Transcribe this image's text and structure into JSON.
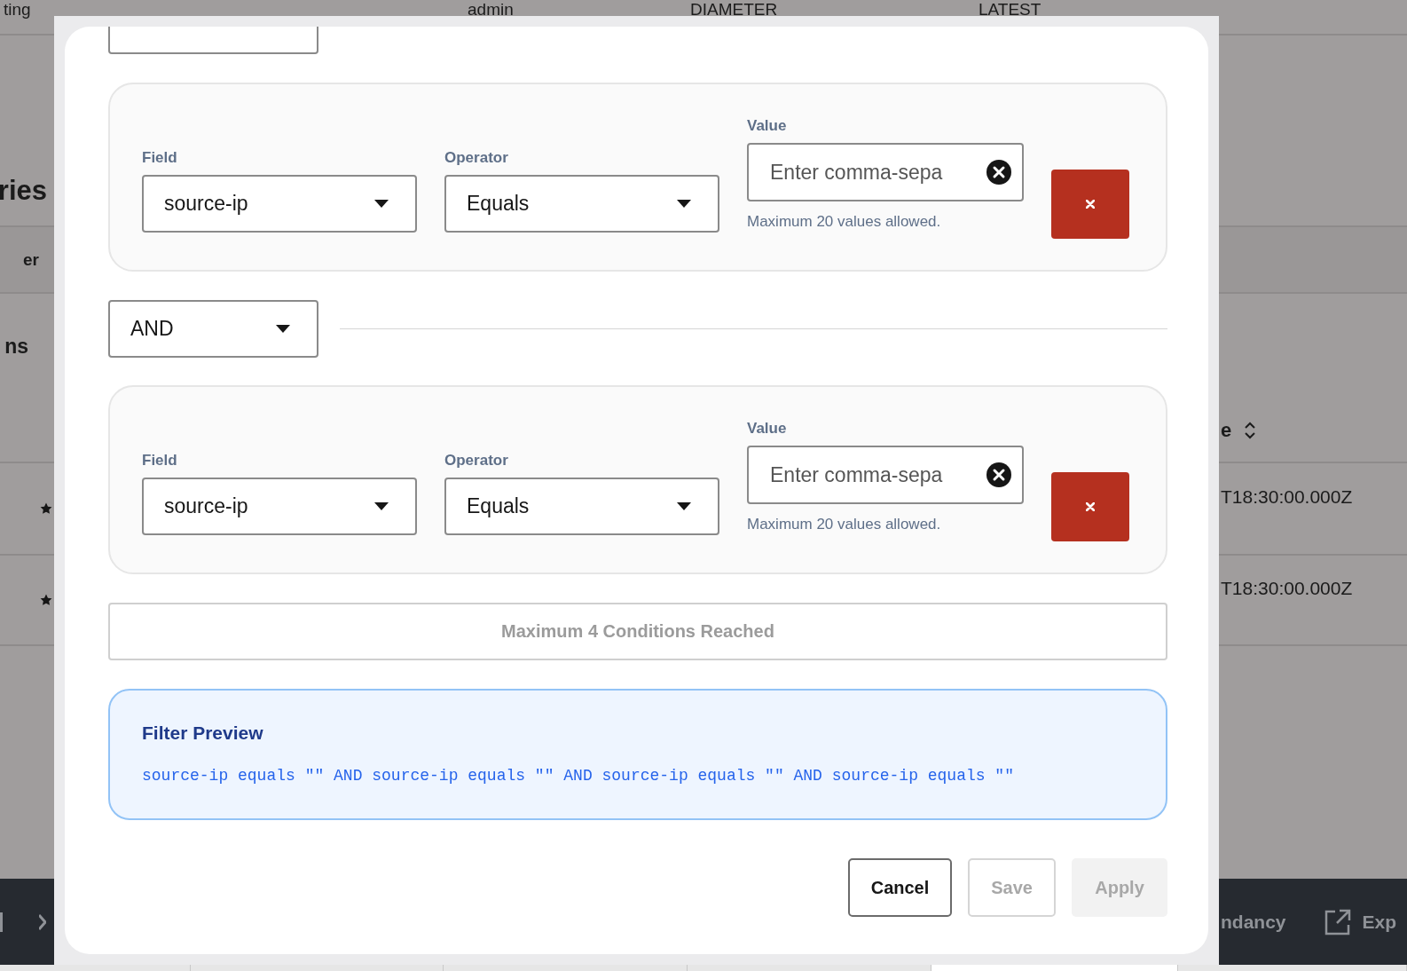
{
  "background": {
    "header_cells": [
      "ting",
      "admin",
      "DIAMETER",
      "LATEST"
    ],
    "left_texts": [
      "ries",
      "er",
      "ns"
    ],
    "sort_header": "e",
    "rows": [
      {
        "timestamp": "T18:30:00.000Z"
      },
      {
        "timestamp": "T18:30:00.000Z"
      }
    ],
    "footer_items": [
      {
        "kind": "text",
        "label": "ndancy"
      },
      {
        "kind": "export",
        "label": "Exp"
      }
    ]
  },
  "dialog": {
    "items": [
      {
        "kind": "join_cut"
      },
      {
        "kind": "condition",
        "field_label": "Field",
        "field": "source-ip",
        "operator_label": "Operator",
        "operator": "Equals",
        "value_label": "Value",
        "value_placeholder": "Enter comma-sepa",
        "hint": "Maximum 20 values allowed."
      },
      {
        "kind": "join",
        "value": "AND"
      },
      {
        "kind": "condition",
        "field_label": "Field",
        "field": "source-ip",
        "operator_label": "Operator",
        "operator": "Equals",
        "value_label": "Value",
        "value_placeholder": "Enter comma-sepa",
        "hint": "Maximum 20 values allowed."
      }
    ],
    "limit_button": {
      "label": "Maximum 4 Conditions Reached",
      "disabled": true
    },
    "preview": {
      "title": "Filter Preview",
      "text": "source-ip equals \"\" AND source-ip equals \"\" AND source-ip equals \"\" AND source-ip equals \"\""
    },
    "actions": [
      {
        "label": "Cancel",
        "kind": "secondary",
        "disabled": false
      },
      {
        "label": "Save",
        "kind": "secondary",
        "disabled": true
      },
      {
        "label": "Apply",
        "kind": "primary",
        "disabled": true
      }
    ]
  }
}
